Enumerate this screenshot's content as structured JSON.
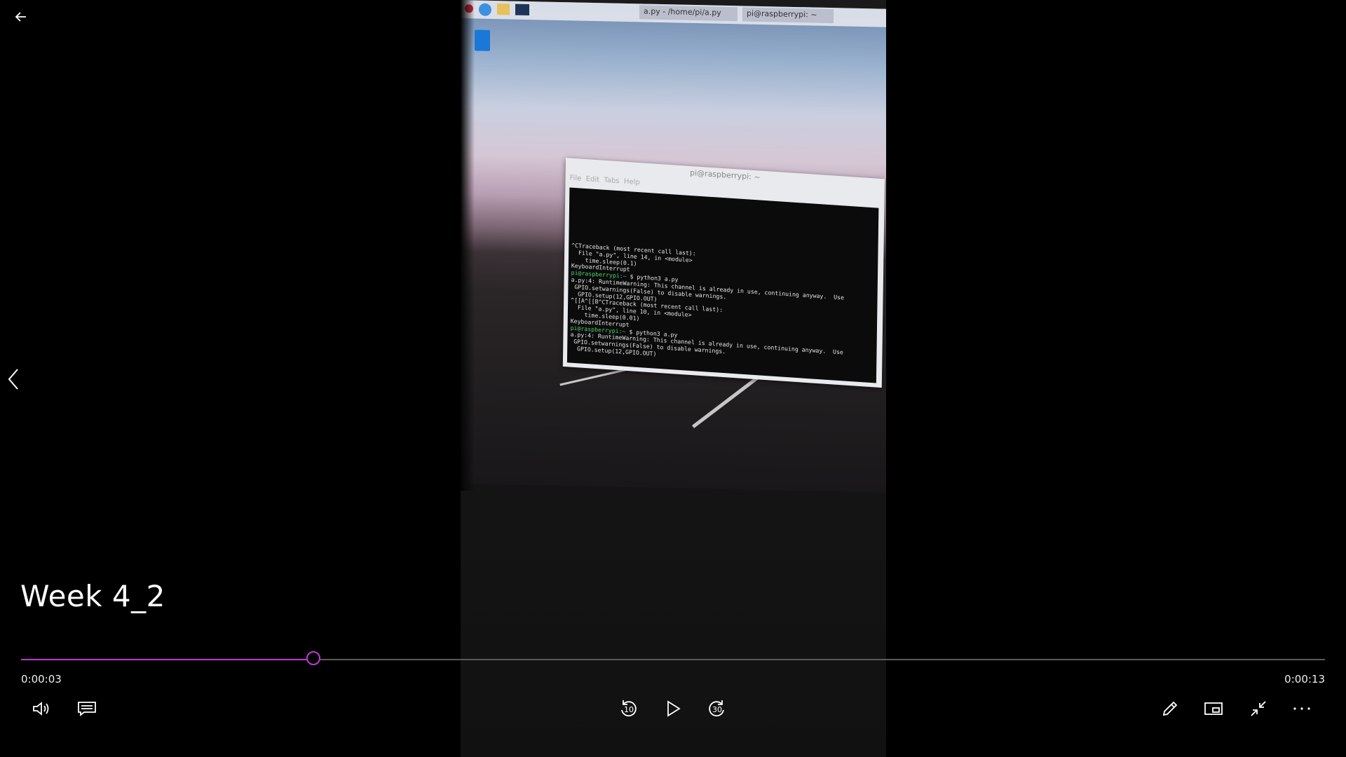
{
  "video": {
    "title": "Week 4_2",
    "elapsed": "0:00:03",
    "duration": "0:00:13",
    "progress_fraction": 0.224
  },
  "controls": {
    "back": "back-arrow-icon",
    "previous": "chevron-left-icon",
    "volume": "volume-icon",
    "captions": "captions-icon",
    "skip_back": "skip-back-icon",
    "skip_back_seconds": "10",
    "play": "play-icon",
    "skip_forward": "skip-forward-icon",
    "skip_forward_seconds": "30",
    "edit": "pencil-icon",
    "mini_view": "mini-view-icon",
    "exit_fullscreen": "exit-fullscreen-icon",
    "more": "more-icon"
  },
  "accent_color": "#c038d0",
  "content": {
    "taskbar_app_1": "a.py - /home/pi/a.py",
    "taskbar_app_2": "pi@raspberrypi: ~",
    "terminal_title": "pi@raspberrypi: ~",
    "terminal_lines": [
      "^CTraceback (most recent call last):",
      "  File \"a.py\", line 14, in <module>",
      "    time.sleep(0.1)",
      "KeyboardInterrupt",
      "pi@raspberrypi:~ $ python3 a.py",
      "a.py:4: RuntimeWarning: This channel is already in use, continuing anyway.  Use",
      " GPIO.setwarnings(False) to disable warnings.",
      "  GPIO.setup(12,GPIO.OUT)",
      "^[[A^[[B^CTraceback (most recent call last):",
      "  File \"a.py\", line 10, in <module>",
      "    time.sleep(0.01)",
      "KeyboardInterrupt",
      "pi@raspberrypi:~ $ python3 a.py",
      "a.py:4: RuntimeWarning: This channel is already in use, continuing anyway.  Use",
      " GPIO.setwarnings(False) to disable warnings.",
      "  GPIO.setup(12,GPIO.OUT)"
    ]
  }
}
